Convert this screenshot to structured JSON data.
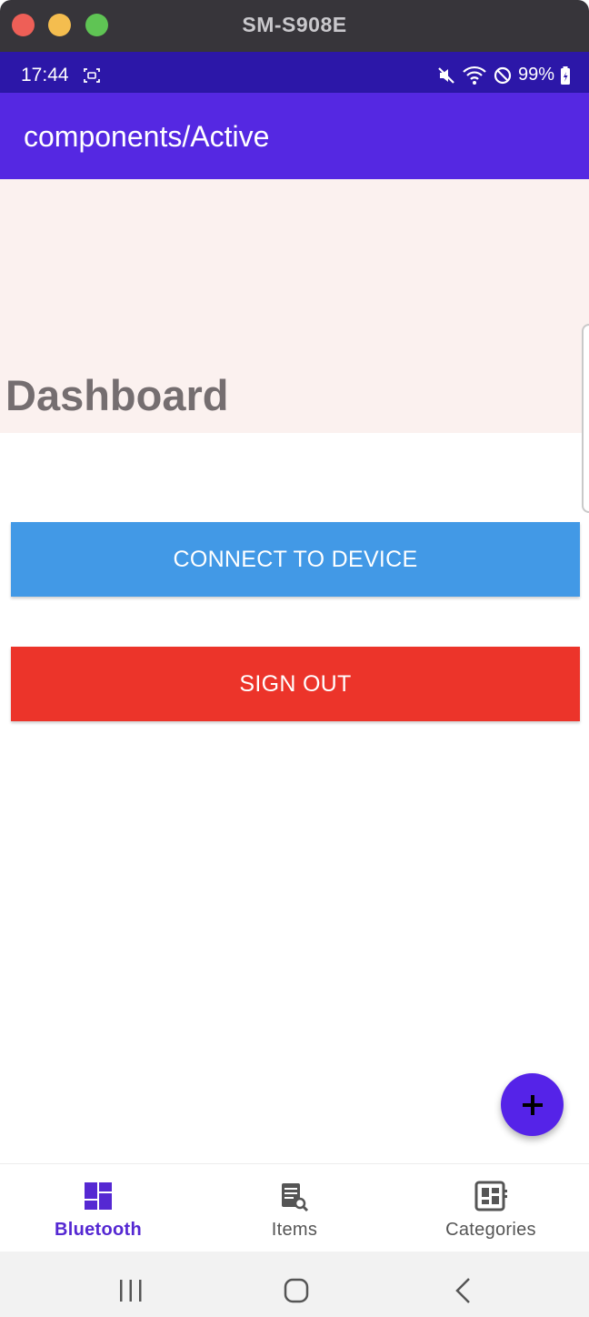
{
  "window": {
    "title": "SM-S908E"
  },
  "status_bar": {
    "time": "17:44",
    "battery": "99%"
  },
  "app_bar": {
    "title": "components/Active"
  },
  "dashboard": {
    "title": "Dashboard"
  },
  "buttons": {
    "connect": "CONNECT TO DEVICE",
    "sign_out": "SIGN OUT"
  },
  "fab": {
    "icon": "plus-icon"
  },
  "bottom_nav": {
    "items": [
      {
        "label": "Bluetooth",
        "icon": "dashboard-icon",
        "active": true
      },
      {
        "label": "Items",
        "icon": "list-search-icon",
        "active": false
      },
      {
        "label": "Categories",
        "icon": "category-grid-icon",
        "active": false
      }
    ]
  },
  "colors": {
    "app_bar": "#5528e2",
    "status_bar": "#2c17a8",
    "connect_button": "#4299e6",
    "sign_out_button": "#ec342a",
    "fab": "#5523e8",
    "active_nav": "#5528d2"
  }
}
